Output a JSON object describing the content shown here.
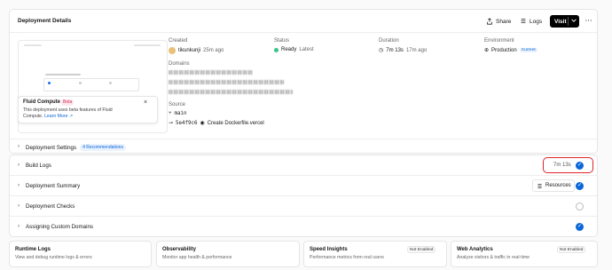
{
  "header": {
    "title": "Deployment Details",
    "share_label": "Share",
    "logs_label": "Logs",
    "visit_label": "Visit",
    "more_label": "···"
  },
  "preview": {
    "fluid_title": "Fluid Compute",
    "beta_label": "Beta",
    "fluid_text": "This deployment uses beta features of Fluid Compute.",
    "learn_more": "Learn More",
    "close_label": "×"
  },
  "meta": {
    "created_label": "Created",
    "created_user": "tikunkunji",
    "created_time": "25m ago",
    "status_label": "Status",
    "status_value": "Ready",
    "status_sub": "Latest",
    "duration_label": "Duration",
    "duration_value": "7m 13s",
    "duration_sub": "17m ago",
    "env_label": "Environment",
    "env_value": "Production",
    "env_badge": "Current",
    "domains_label": "Domains",
    "source_label": "Source",
    "branch": "main",
    "commit_hash": "5e4f9c6",
    "commit_msg": "Create Dockerfile.vercel"
  },
  "settings": {
    "label": "Deployment Settings",
    "badge": "4 Recommendations"
  },
  "rows": {
    "build_logs": "Build Logs",
    "build_duration": "7m 13s",
    "summary": "Deployment Summary",
    "resources": "Resources",
    "checks": "Deployment Checks",
    "domains": "Assigning Custom Domains"
  },
  "cards": [
    {
      "title": "Runtime Logs",
      "sub": "View and debug runtime logs & errors",
      "badge": ""
    },
    {
      "title": "Observability",
      "sub": "Monitor app health & performance",
      "badge": ""
    },
    {
      "title": "Speed Insights",
      "sub": "Performance metrics from real users",
      "badge": "Not Enabled"
    },
    {
      "title": "Web Analytics",
      "sub": "Analyze visitors & traffic in real-time",
      "badge": "Not Enabled"
    }
  ],
  "colors": {
    "accent": "#0b67d8",
    "ready": "#36c58a",
    "highlight": "#e0242d"
  }
}
